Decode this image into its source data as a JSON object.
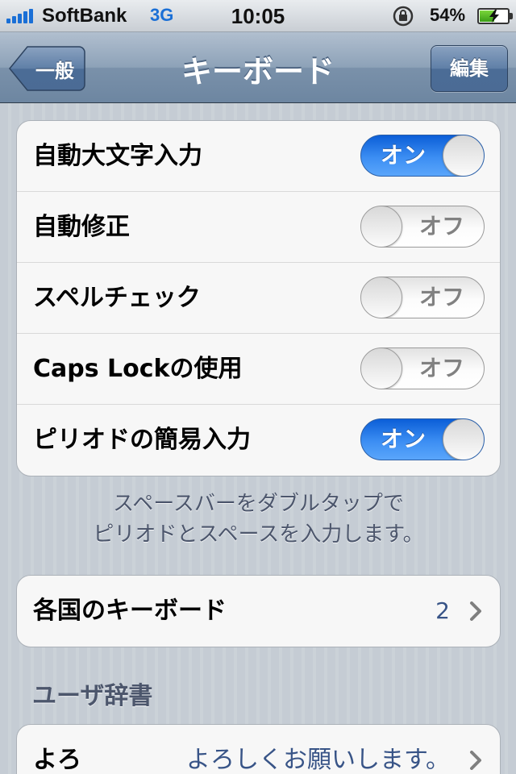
{
  "status_bar": {
    "carrier": "SoftBank",
    "network": "3G",
    "time": "10:05",
    "battery_percent": "54%",
    "battery_level": 0.54
  },
  "nav": {
    "back_label": "一般",
    "title": "キーボード",
    "edit_label": "編集"
  },
  "settings": [
    {
      "label": "自動大文字入力",
      "state": "オン",
      "on": true
    },
    {
      "label": "自動修正",
      "state": "オフ",
      "on": false
    },
    {
      "label": "スペルチェック",
      "state": "オフ",
      "on": false
    },
    {
      "label": "Caps Lockの使用",
      "state": "オフ",
      "on": false
    },
    {
      "label": "ピリオドの簡易入力",
      "state": "オン",
      "on": true
    }
  ],
  "footer": {
    "line1": "スペースバーをダブルタップで",
    "line2": "ピリオドとスペースを入力します。"
  },
  "international": {
    "label": "各国のキーボード",
    "value": "2"
  },
  "user_dictionary": {
    "header": "ユーザ辞書",
    "entries": [
      {
        "shortcut": "よろ",
        "phrase": "よろしくお願いします。"
      }
    ]
  },
  "colors": {
    "accent_on": "#2f7ff0",
    "nav_bar": "#7a91aa",
    "background": "#c5ccd4"
  }
}
